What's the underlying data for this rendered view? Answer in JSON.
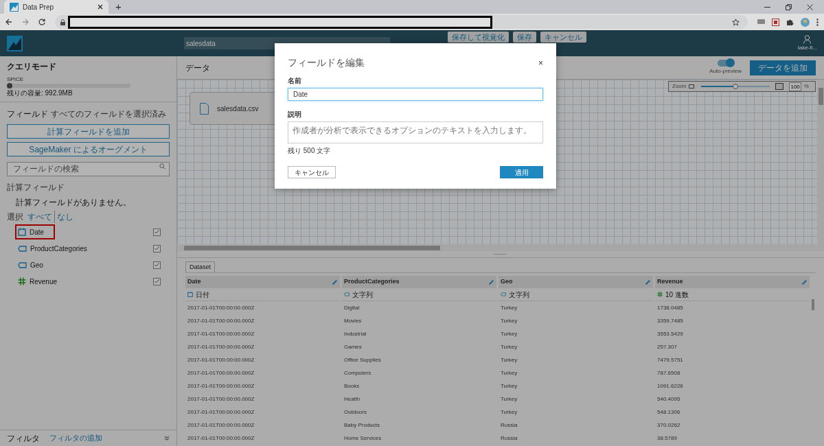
{
  "browser": {
    "tab_title": "Data Prep",
    "new_tab": "+"
  },
  "header": {
    "dataset_name": "salesdata",
    "buttons": [
      "保存して視覚化",
      "保存",
      "キャンセル"
    ],
    "user": "lake-fi..."
  },
  "sidebar": {
    "query_mode_title": "クエリモード",
    "spice_label": "SPICE",
    "capacity": "残りの容量: 992.9MB",
    "fields_title": "フィールド",
    "fields_status": "すべてのフィールドを選択済み",
    "add_calc_button": "計算フィールドを追加",
    "sagemaker_button": "SageMaker によるオーグメント",
    "search_placeholder": "フィールドの検索",
    "calc_title": "計算フィールド",
    "calc_empty": "計算フィールドがありません。",
    "select_label": "選択",
    "select_all": "すべて",
    "select_none": "なし",
    "fields": [
      {
        "name": "Date",
        "kind": "date",
        "checked": true,
        "highlighted": true
      },
      {
        "name": "ProductCategories",
        "kind": "string",
        "checked": true,
        "highlighted": false
      },
      {
        "name": "Geo",
        "kind": "string",
        "checked": true,
        "highlighted": false
      },
      {
        "name": "Revenue",
        "kind": "number",
        "checked": true,
        "highlighted": false
      }
    ],
    "filter_title": "フィルタ",
    "filter_add": "フィルタの追加"
  },
  "data_panel": {
    "title": "データ",
    "auto_preview": {
      "label": "Auto-preview",
      "on": true
    },
    "add_data_button": "データを追加",
    "zoom": {
      "label": "Zoom",
      "level": 0.5,
      "value": "100",
      "unit": "%"
    },
    "source_card": "salesdata.csv"
  },
  "preview": {
    "tab": "Dataset",
    "columns": [
      {
        "name": "Date",
        "kind": "date",
        "type": "日付"
      },
      {
        "name": "ProductCategories",
        "kind": "string",
        "type": "文字列"
      },
      {
        "name": "Geo",
        "kind": "string",
        "type": "文字列"
      },
      {
        "name": "Revenue",
        "kind": "number",
        "type": "10 進数"
      }
    ],
    "rows": [
      [
        "2017-01-01T00:00:00.000Z",
        "Digital",
        "Turkey",
        "1738.0485"
      ],
      [
        "2017-01-01T00:00:00.000Z",
        "Movies",
        "Turkey",
        "3359.7485"
      ],
      [
        "2017-01-01T00:00:00.000Z",
        "Industrial",
        "Turkey",
        "3553.5429"
      ],
      [
        "2017-01-01T00:00:00.000Z",
        "Games",
        "Turkey",
        "257.307"
      ],
      [
        "2017-01-01T00:00:00.000Z",
        "Office Supplies",
        "Turkey",
        "7479.5751"
      ],
      [
        "2017-01-01T00:00:00.000Z",
        "Computers",
        "Turkey",
        "787.6508"
      ],
      [
        "2017-01-01T00:00:00.000Z",
        "Books",
        "Turkey",
        "1091.6226"
      ],
      [
        "2017-01-01T00:00:00.000Z",
        "Health",
        "Turkey",
        "540.4095"
      ],
      [
        "2017-01-01T00:00:00.000Z",
        "Outdoors",
        "Turkey",
        "548.1306"
      ],
      [
        "2017-01-01T00:00:00.000Z",
        "Baby Products",
        "Russia",
        "370.0262"
      ],
      [
        "2017-01-01T00:00:00.000Z",
        "Home Services",
        "Russia",
        "38.5789"
      ]
    ]
  },
  "dialog": {
    "title": "フィールドを編集",
    "close": "×",
    "name_label": "名前",
    "name_value": "Date",
    "description_label": "説明",
    "description_placeholder": "作成者が分析で表示できるオプションのテキストを入力します。",
    "remaining": "残り 500 文字",
    "cancel_button": "キャンセル",
    "apply_button": "適用"
  }
}
